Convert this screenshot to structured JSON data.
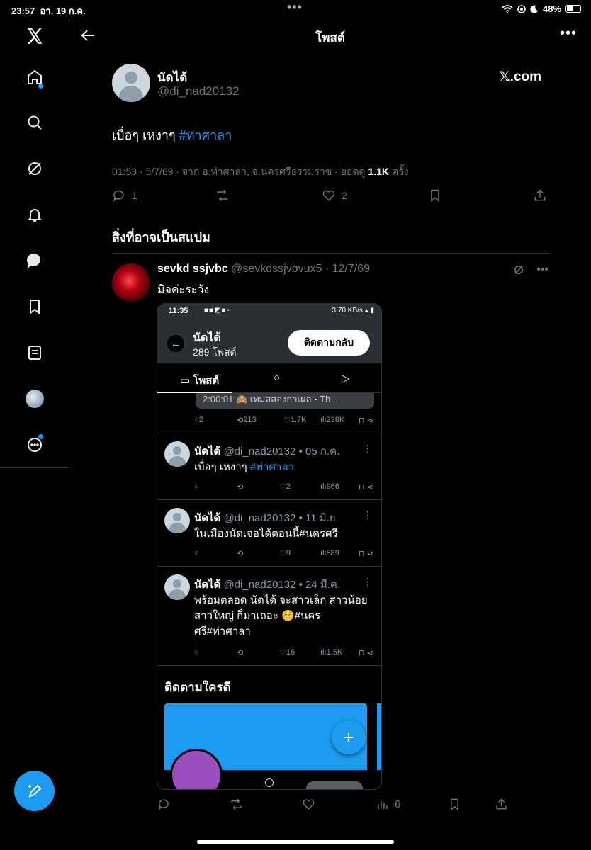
{
  "status_bar": {
    "time": "23:57",
    "date": "อา. 19 ก.ค.",
    "battery": "48%"
  },
  "header": {
    "title": "โพสต์"
  },
  "post": {
    "name": "นัดได้",
    "handle": "@di_nad20132",
    "source_label": "𝕏.com",
    "text": "เบื่อๆ เหงาๆ",
    "hashtag": "#ท่าศาลา",
    "meta": "01:53 · 5/7/69 · จาก อ.ท่าศาลา, จ.นครศรีธรรมราช · ยอดดู",
    "views": "1.1K",
    "views_suffix": "ครั้ง",
    "replies": "1",
    "likes": "2"
  },
  "spam_section": {
    "heading": "สิ่งที่อาจเป็นสแปม"
  },
  "reply": {
    "name": "sevkd ssjvbc",
    "handle": "@sevkdssjvbvux5",
    "date": "· 12/7/69",
    "text": "มิจค่ะระวัง",
    "views": "6"
  },
  "embedded": {
    "time": "11:35",
    "status_right": "3.70 KB/s",
    "profile_name": "นัดได้",
    "post_count": "289 โพสต์",
    "follow_button": "ติดตามกลับ",
    "tab_posts": "โพสต์",
    "preview_text": "2:00:01 🙈 เทมสสองกาเผล - Th...",
    "top_stats": {
      "replies": "2",
      "retweets": "213",
      "likes": "1.7K",
      "views": "238K"
    },
    "tweets": [
      {
        "name": "นัดได้",
        "meta": "@di_nad20132 • 05 ก.ค.",
        "text": "เบื่อๆ เหงาๆ",
        "hashtag": "#ท่าศาลา",
        "likes": "2",
        "views": "966"
      },
      {
        "name": "นัดได้",
        "meta": "@di_nad20132 • 11 มิ.ย.",
        "text": "ในเมืองนัดเจอได้ตอนนี้#นครศรี",
        "likes": "9",
        "views": "589"
      },
      {
        "name": "นัดได้",
        "meta": "@di_nad20132 • 24 มี.ค.",
        "text": "พร้อมตลอด นัดได้ จะสาวเล็ก สาวน้อย สาวใหญ่ ก็มาเถอะ ☺️#นครศรี#ท่าศาลา",
        "likes": "16",
        "views": "1.5K"
      }
    ],
    "who_to_follow": "ติดตามใครดี"
  },
  "colors": {
    "accent": "#1d9bf0",
    "background": "#000000",
    "muted": "#71767b",
    "divider": "#2f3336"
  }
}
